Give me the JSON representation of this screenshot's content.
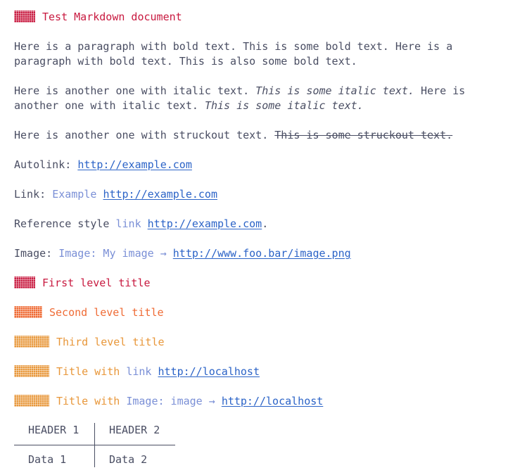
{
  "colors": {
    "text": "#4a4e63",
    "h1": "#c8193f",
    "h2": "#ef6b35",
    "h3": "#e8973a",
    "url": "#2b63c7",
    "linktext": "#7a8fd6",
    "rule": "#4a4e63"
  },
  "doc": {
    "title": "Test Markdown document",
    "bold_para": {
      "text": "Here is a paragraph with bold text. This is some bold text. Here is a paragraph with bold text. This is also some bold text."
    },
    "italic_para": {
      "p1": "Here is another one with italic text. ",
      "i1": "This is some italic text.",
      "p2": " Here is another one with italic text. ",
      "i2": "This is some italic text."
    },
    "strike_para": {
      "prefix": "Here is another one with struckout text. ",
      "struck": "This is some struckout text."
    },
    "autolink": {
      "label": "Autolink: ",
      "url": "http://example.com"
    },
    "link": {
      "label": "Link: ",
      "text": "Example",
      "url": "http://example.com"
    },
    "ref_link": {
      "label": "Reference style ",
      "text": "link",
      "url": "http://example.com",
      "suffix": "."
    },
    "image": {
      "label": "Image: ",
      "text": "Image: My image",
      "arrow": "→",
      "url": "http://www.foo.bar/image.png"
    },
    "heading1": "First level title",
    "heading2": "Second level title",
    "heading3": "Third level title",
    "heading_link": {
      "prefix": "Title with ",
      "text": "link",
      "url": "http://localhost"
    },
    "heading_image": {
      "prefix": "Title with ",
      "text": "Image: image",
      "arrow": "→",
      "url": "http://localhost"
    },
    "table": {
      "headers": [
        "HEADER 1",
        "HEADER 2"
      ],
      "rows": [
        [
          "Data 1",
          "Data 2"
        ]
      ]
    }
  }
}
